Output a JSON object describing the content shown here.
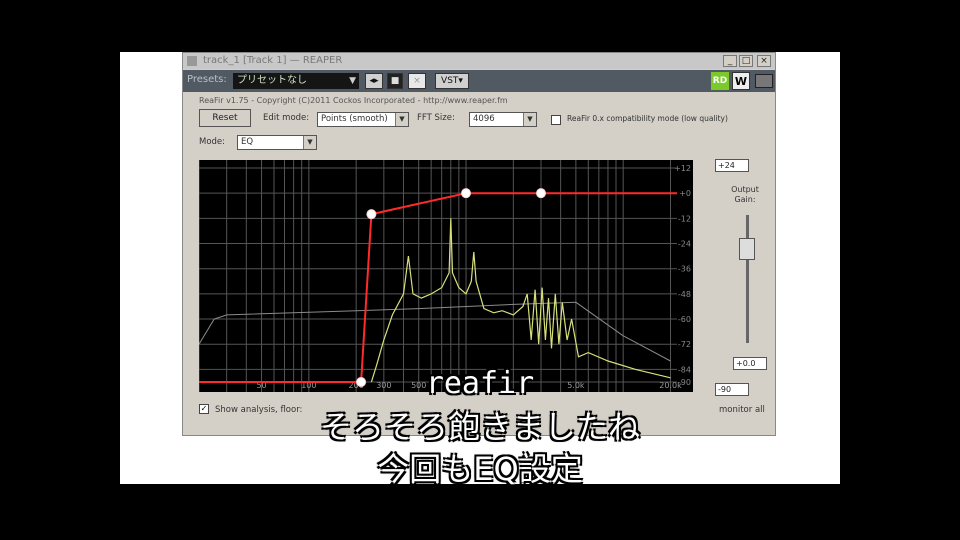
{
  "window": {
    "title": "track_1 [Track 1] — REAPER",
    "controls": {
      "minimize": "_",
      "maximize": "□",
      "close": "×"
    }
  },
  "presetbar": {
    "label": "Presets:",
    "preset_value": "プリセットなし",
    "vst_label": "VST▾",
    "rd_label": "RD",
    "w_label": "W"
  },
  "plugin": {
    "copyright": "ReaFir v1.75 - Copyright (C)2011 Cockos Incorporated - http://www.reaper.fm",
    "reset_label": "Reset",
    "edit_mode_label": "Edit mode:",
    "edit_mode_value": "Points (smooth)",
    "fft_size_label": "FFT Size:",
    "fft_size_value": "4096",
    "compat_label": "ReaFir 0.x compatibility mode (low quality)",
    "mode_label": "Mode:",
    "mode_value": "EQ",
    "show_analysis_label": "Show analysis, floor:",
    "monitor_all_label": "monitor all",
    "output_gain_label_1": "Output",
    "output_gain_label_2": "Gain:",
    "range_value": "+24",
    "gain_value": "+0.0",
    "floor_value": "-90"
  },
  "graph": {
    "db_ticks": [
      "+12",
      "+0",
      "-12",
      "-24",
      "-36",
      "-48",
      "-60",
      "-72",
      "-84",
      "-90"
    ],
    "freq_ticks": [
      "50",
      "100",
      "200",
      "300",
      "500",
      "5.0k",
      "20.0k"
    ],
    "eq_points": [
      {
        "freq_hz": 20,
        "gain_db": -90
      },
      {
        "freq_hz": 215,
        "gain_db": -90
      },
      {
        "freq_hz": 250,
        "gain_db": -10
      },
      {
        "freq_hz": 1000,
        "gain_db": 0
      },
      {
        "freq_hz": 3000,
        "gain_db": 0
      }
    ],
    "colors": {
      "eq_curve": "#ff2a2a",
      "spectrum": "#d8e07a",
      "floor_curve": "#8a8a8a",
      "grid": "#555"
    }
  },
  "subtitles": {
    "line1": "reafir",
    "line2": "そろそろ飽きましたね",
    "line3": "今回もEQ設定"
  }
}
